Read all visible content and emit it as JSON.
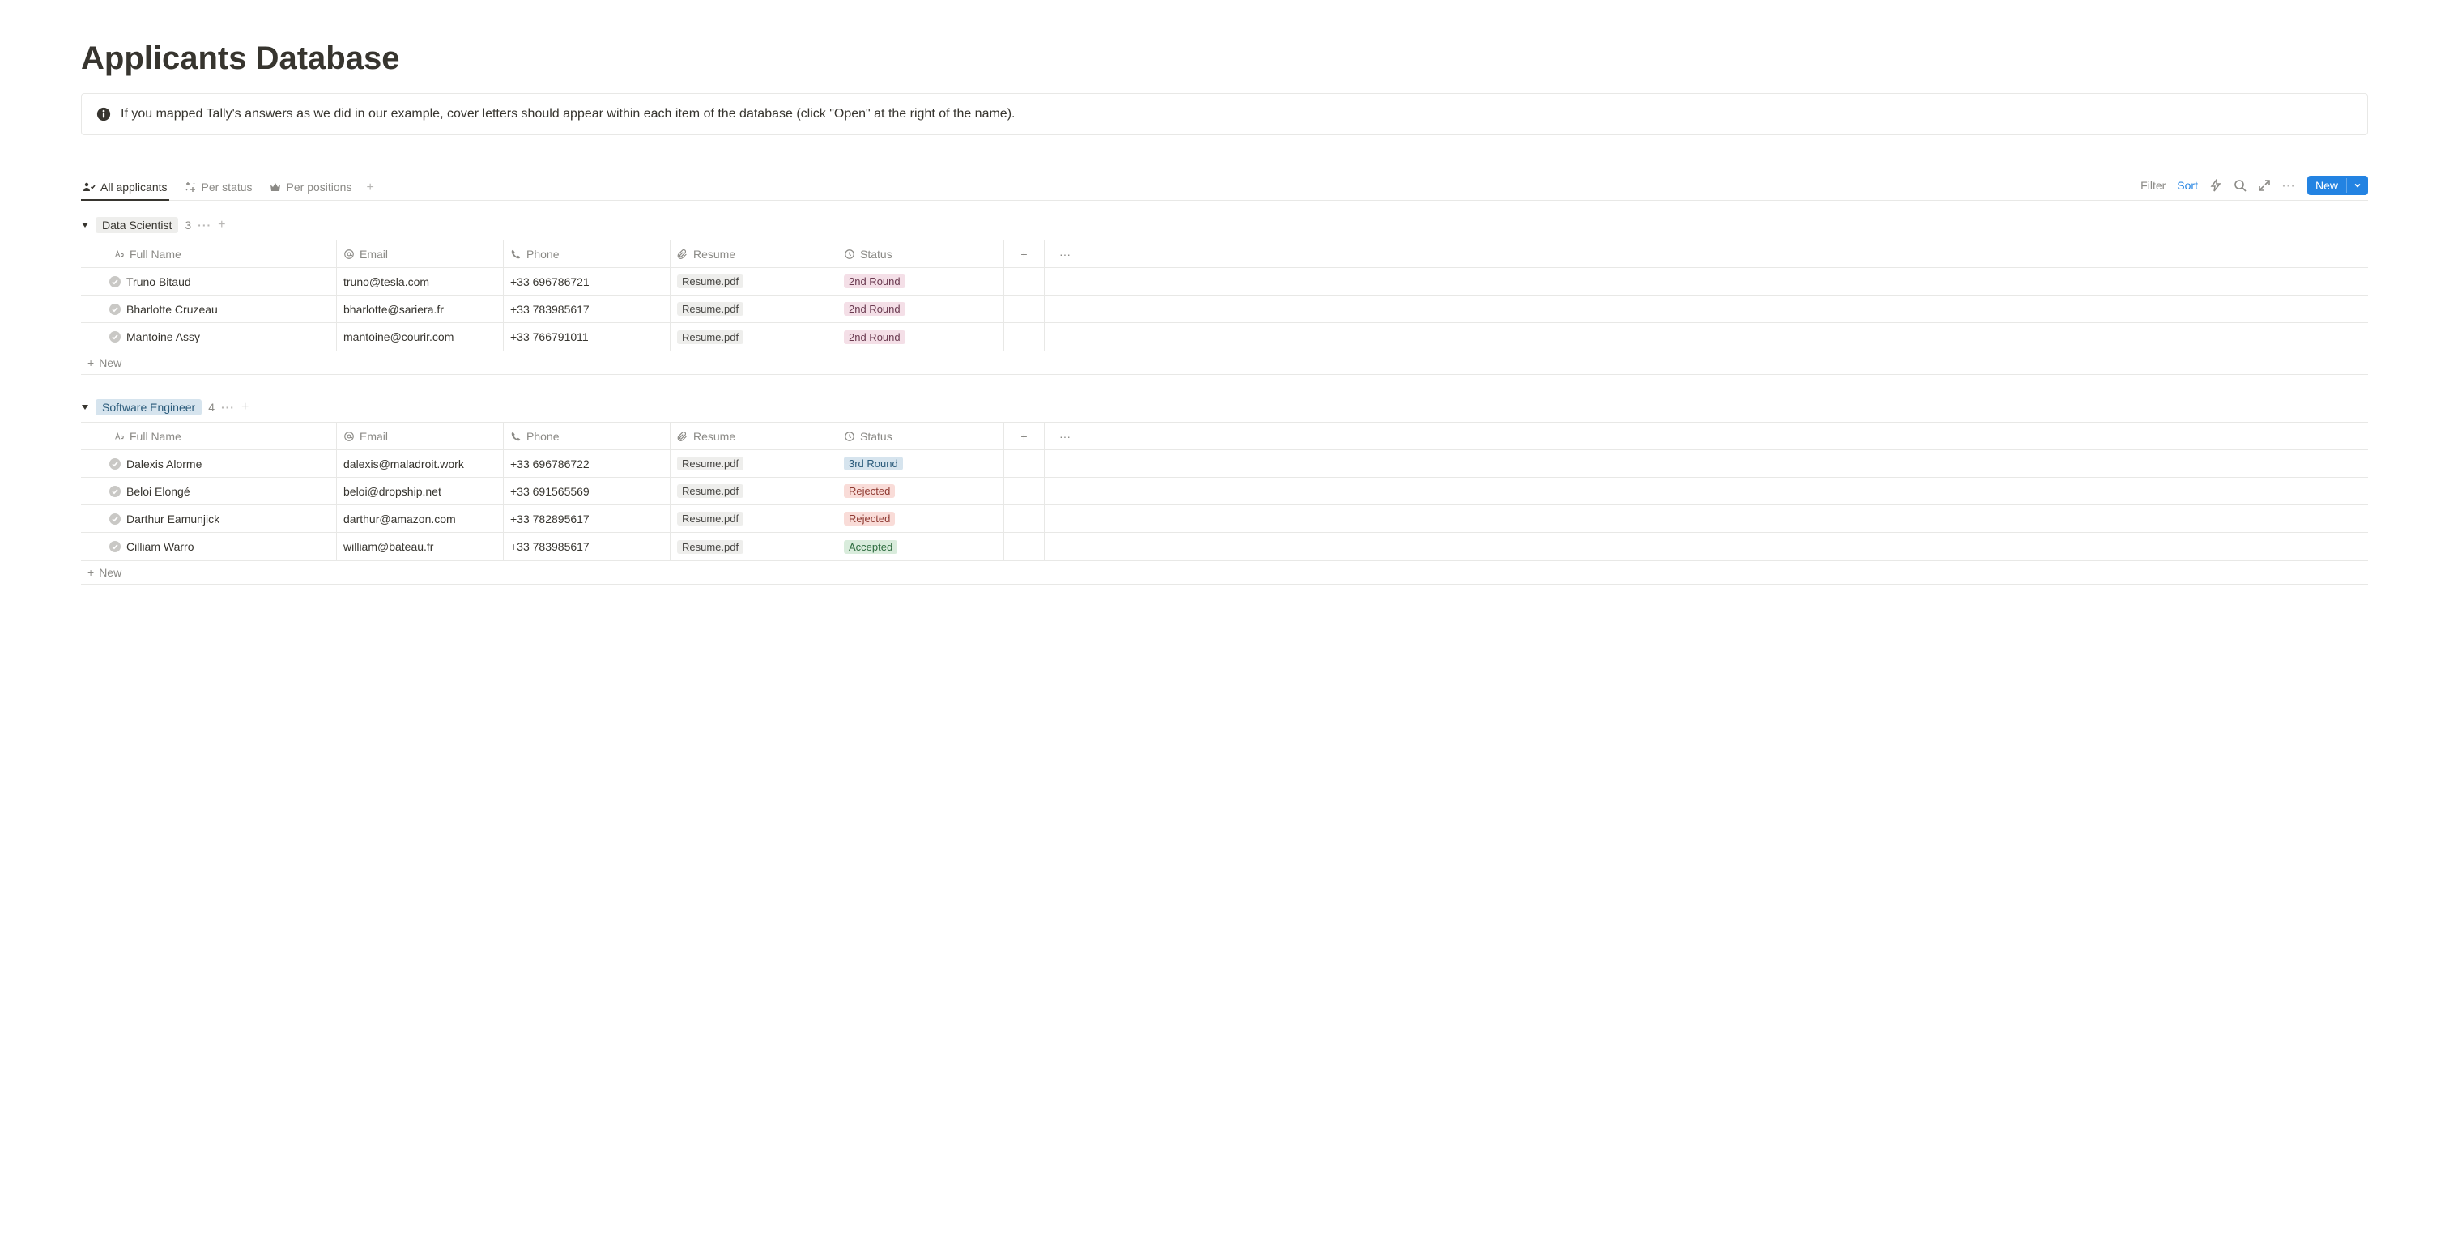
{
  "page": {
    "title": "Applicants Database"
  },
  "callout": {
    "text": "If you mapped Tally's answers as we did in our example, cover letters should appear within each item of the database (click \"Open\" at the right of the name)."
  },
  "views": {
    "tabs": [
      {
        "label": "All applicants",
        "active": true,
        "icon": "people"
      },
      {
        "label": "Per status",
        "active": false,
        "icon": "sparkle"
      },
      {
        "label": "Per positions",
        "active": false,
        "icon": "crown"
      }
    ],
    "actions": {
      "filter": "Filter",
      "sort": "Sort",
      "new": "New"
    }
  },
  "columns": {
    "name": "Full Name",
    "email": "Email",
    "phone": "Phone",
    "resume": "Resume",
    "status": "Status"
  },
  "groups": [
    {
      "name": "Data Scientist",
      "tagClass": "tag-gray",
      "count": "3",
      "rows": [
        {
          "name": "Truno Bitaud",
          "email": "truno@tesla.com",
          "phone": "+33 696786721",
          "resume": "Resume.pdf",
          "status": "2nd Round",
          "statusClass": "pill-2nd"
        },
        {
          "name": "Bharlotte Cruzeau",
          "email": "bharlotte@sariera.fr",
          "phone": "+33 783985617",
          "resume": "Resume.pdf",
          "status": "2nd Round",
          "statusClass": "pill-2nd"
        },
        {
          "name": "Mantoine Assy",
          "email": "mantoine@courir.com",
          "phone": "+33 766791011",
          "resume": "Resume.pdf",
          "status": "2nd Round",
          "statusClass": "pill-2nd"
        }
      ]
    },
    {
      "name": "Software Engineer",
      "tagClass": "tag-blue-light",
      "count": "4",
      "rows": [
        {
          "name": "Dalexis Alorme",
          "email": "dalexis@maladroit.work",
          "phone": "+33 696786722",
          "resume": "Resume.pdf",
          "status": "3rd Round",
          "statusClass": "pill-3rd"
        },
        {
          "name": "Beloi Elongé",
          "email": "beloi@dropship.net",
          "phone": "+33 691565569",
          "resume": "Resume.pdf",
          "status": "Rejected",
          "statusClass": "pill-rejected"
        },
        {
          "name": "Darthur Eamunjick",
          "email": "darthur@amazon.com",
          "phone": "+33 782895617",
          "resume": "Resume.pdf",
          "status": "Rejected",
          "statusClass": "pill-rejected"
        },
        {
          "name": "Cilliam Warro",
          "email": "william@bateau.fr",
          "phone": "+33 783985617",
          "resume": "Resume.pdf",
          "status": "Accepted",
          "statusClass": "pill-accepted"
        }
      ]
    }
  ],
  "newRowLabel": "New"
}
